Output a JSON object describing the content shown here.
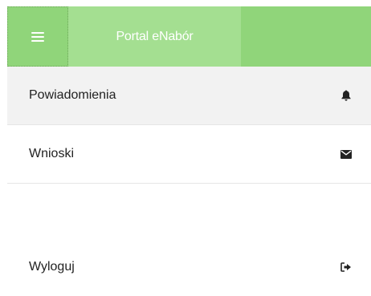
{
  "topbar": {
    "menu_icon": "hamburger-icon",
    "brand": "Portal eNabór",
    "colors": {
      "bar": "#90d57a",
      "brand_bg": "#a4df91",
      "text": "#ffffff"
    }
  },
  "nav": {
    "items": [
      {
        "label": "Powiadomienia",
        "icon": "bell-icon",
        "active": true
      },
      {
        "label": "Wnioski",
        "icon": "envelope-icon",
        "active": false
      },
      {
        "label": "Wyloguj",
        "icon": "sign-out-icon",
        "active": false
      }
    ]
  }
}
